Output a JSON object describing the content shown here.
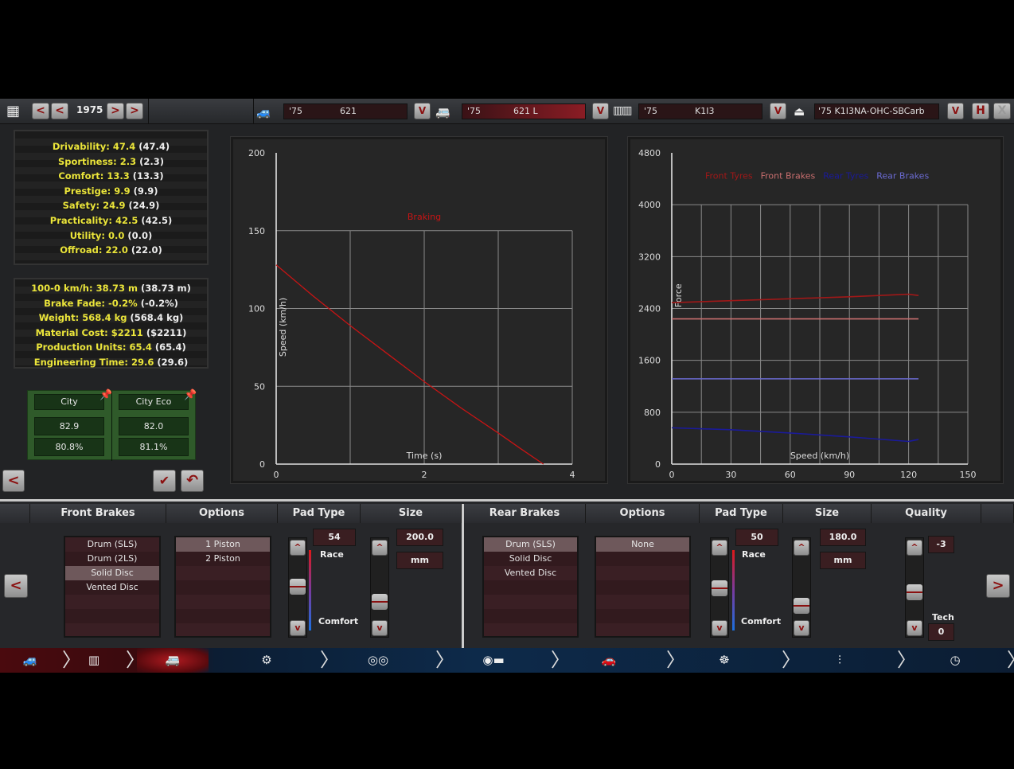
{
  "toolbar": {
    "year": "1975",
    "prev_fast": "<",
    "prev": "<",
    "next": ">",
    "next_fast": ">",
    "model": {
      "year": "'75",
      "name": "621"
    },
    "trim": {
      "year": "'75",
      "name": "621 L"
    },
    "engine": {
      "year": "'75",
      "name": "K1I3"
    },
    "engine_variant": {
      "name": "'75 K1I3NA-OHC-SBCarb"
    },
    "dropdown": "V",
    "save": "H",
    "close": "X"
  },
  "stats": [
    {
      "label": "Drivability:",
      "value": "47.4",
      "prev": "(47.4)"
    },
    {
      "label": "Sportiness:",
      "value": "2.3",
      "prev": "(2.3)"
    },
    {
      "label": "Comfort:",
      "value": "13.3",
      "prev": "(13.3)"
    },
    {
      "label": "Prestige:",
      "value": "9.9",
      "prev": "(9.9)"
    },
    {
      "label": "Safety:",
      "value": "24.9",
      "prev": "(24.9)"
    },
    {
      "label": "Practicality:",
      "value": "42.5",
      "prev": "(42.5)"
    },
    {
      "label": "Utility:",
      "value": "0.0",
      "prev": "(0.0)"
    },
    {
      "label": "Offroad:",
      "value": "22.0",
      "prev": "(22.0)"
    }
  ],
  "specs": [
    {
      "label": "100-0 km/h:",
      "value": "38.73 m",
      "prev": "(38.73 m)"
    },
    {
      "label": "Brake Fade:",
      "value": "-0.2%",
      "prev": "(-0.2%)"
    },
    {
      "label": "Weight:",
      "value": "568.4 kg",
      "prev": "(568.4 kg)"
    },
    {
      "label": "Material Cost:",
      "value": "$2211",
      "prev": "($2211)"
    },
    {
      "label": "Production Units:",
      "value": "65.4",
      "prev": "(65.4)"
    },
    {
      "label": "Engineering Time:",
      "value": "29.6",
      "prev": "(29.6)"
    }
  ],
  "demographics": [
    {
      "name": "City",
      "score": "82.9",
      "percent": "80.8%"
    },
    {
      "name": "City Eco",
      "score": "82.0",
      "percent": "81.1%"
    }
  ],
  "left_buttons": {
    "back": "<"
  },
  "chart_data": [
    {
      "type": "line",
      "title": "",
      "xlabel": "Time (s)",
      "ylabel": "Speed (km/h)",
      "xlim": [
        0,
        4
      ],
      "ylim": [
        0,
        200
      ],
      "xticks": [
        0,
        2,
        4
      ],
      "yticks": [
        0,
        50,
        100,
        150,
        200
      ],
      "grid": true,
      "legend": "top-center",
      "series": [
        {
          "name": "Braking",
          "color": "#c81414",
          "x": [
            0,
            0.5,
            1,
            1.5,
            2,
            2.5,
            3,
            3.3,
            3.61
          ],
          "y": [
            128,
            108,
            89,
            71,
            53,
            36,
            20,
            10,
            0
          ]
        }
      ]
    },
    {
      "type": "line",
      "title": "",
      "xlabel": "Speed (km/h)",
      "ylabel": "Force",
      "xlim": [
        0,
        150
      ],
      "ylim": [
        0,
        4800
      ],
      "xticks": [
        0,
        30,
        60,
        90,
        120,
        150
      ],
      "yticks": [
        0,
        800,
        1600,
        2400,
        3200,
        4000,
        4800
      ],
      "grid": true,
      "legend": "top-center",
      "series": [
        {
          "name": "Front Tyres",
          "color": "#a01818",
          "x": [
            0,
            30,
            60,
            90,
            120,
            125
          ],
          "y": [
            2490,
            2520,
            2550,
            2580,
            2620,
            2600
          ]
        },
        {
          "name": "Front Brakes",
          "color": "#c86e6e",
          "x": [
            0,
            125
          ],
          "y": [
            2240,
            2240
          ]
        },
        {
          "name": "Rear Tyres",
          "color": "#1a1a9a",
          "x": [
            0,
            30,
            60,
            90,
            120,
            125
          ],
          "y": [
            560,
            530,
            480,
            420,
            350,
            380
          ]
        },
        {
          "name": "Rear Brakes",
          "color": "#6a6ad0",
          "x": [
            0,
            125
          ],
          "y": [
            1315,
            1315
          ]
        }
      ]
    }
  ],
  "front": {
    "header": "Front Brakes",
    "options_header": "Options",
    "pad_header": "Pad Type",
    "size_header": "Size",
    "types": [
      "Drum (SLS)",
      "Drum (2LS)",
      "Solid Disc",
      "Vented Disc"
    ],
    "selected_type": 2,
    "options": [
      "1 Piston",
      "2 Piston"
    ],
    "selected_option": 0,
    "pad_value": "54",
    "pad_high": "Race",
    "pad_low": "Comfort",
    "size_value": "200.0",
    "size_unit": "mm"
  },
  "rear": {
    "header": "Rear Brakes",
    "options_header": "Options",
    "pad_header": "Pad Type",
    "size_header": "Size",
    "types": [
      "Drum (SLS)",
      "Solid Disc",
      "Vented Disc"
    ],
    "selected_type": 0,
    "options": [
      "None"
    ],
    "selected_option": 0,
    "pad_value": "50",
    "pad_high": "Race",
    "pad_low": "Comfort",
    "size_value": "180.0",
    "size_unit": "mm"
  },
  "quality": {
    "header": "Quality",
    "value": "-3",
    "tech_label": "Tech",
    "tech_value": "0"
  },
  "nav": {
    "prev": "<",
    "next": ">",
    "up": "^",
    "down": "v"
  },
  "bottom_nav": [
    {
      "icon": "car-body-icon",
      "active": false
    },
    {
      "icon": "chassis-icon",
      "active": false
    },
    {
      "icon": "car-trim-icon",
      "active": true
    },
    {
      "icon": "drivetrain-icon",
      "active": false
    },
    {
      "icon": "wheels-icon",
      "active": false
    },
    {
      "icon": "brakes-icon",
      "active": false
    },
    {
      "icon": "aero-cooling-icon",
      "active": false
    },
    {
      "icon": "interior-icon",
      "active": false
    },
    {
      "icon": "suspension-icon",
      "active": false
    },
    {
      "icon": "testing-icon",
      "active": false
    }
  ]
}
